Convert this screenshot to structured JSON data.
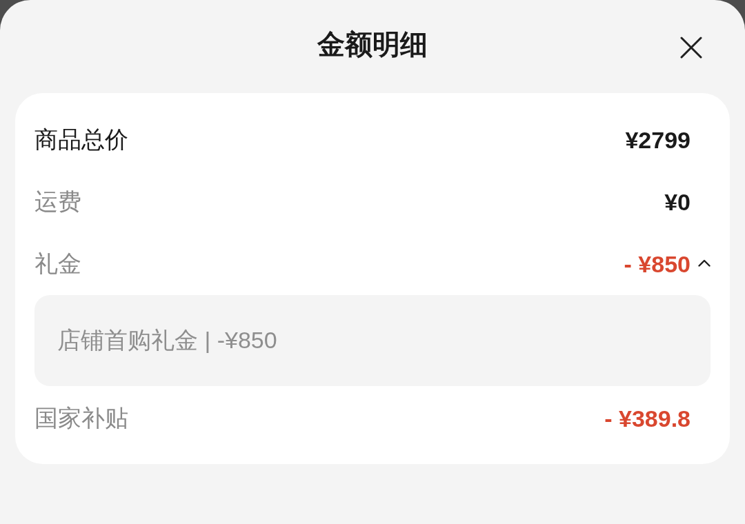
{
  "sheet": {
    "title": "金额明细"
  },
  "rows": [
    {
      "label": "商品总价",
      "value": "¥2799",
      "kind": "total"
    },
    {
      "label": "运费",
      "value": "¥0",
      "kind": "plain"
    },
    {
      "label": "礼金",
      "value": "- ¥850",
      "kind": "discount",
      "expanded": true,
      "details": [
        "店铺首购礼金 | -¥850"
      ]
    },
    {
      "label": "国家补贴",
      "value": "- ¥389.8",
      "kind": "discount"
    }
  ]
}
